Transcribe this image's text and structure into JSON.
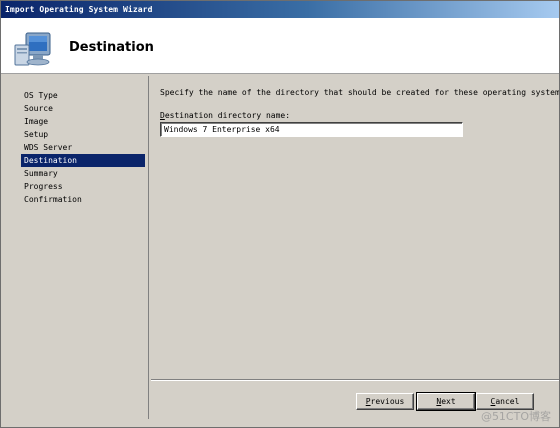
{
  "window": {
    "title": "Import Operating System Wizard"
  },
  "header": {
    "title": "Destination",
    "icon": "computer-monitor-icon"
  },
  "sidebar": {
    "items": [
      {
        "label": "OS Type",
        "selected": false
      },
      {
        "label": "Source",
        "selected": false
      },
      {
        "label": "Image",
        "selected": false
      },
      {
        "label": "Setup",
        "selected": false
      },
      {
        "label": "WDS Server",
        "selected": false
      },
      {
        "label": "Destination",
        "selected": true
      },
      {
        "label": "Summary",
        "selected": false
      },
      {
        "label": "Progress",
        "selected": false
      },
      {
        "label": "Confirmation",
        "selected": false
      }
    ]
  },
  "main": {
    "instruction": "Specify the name of the directory that should be created for these operating system fi",
    "field_label_accel": "D",
    "field_label_rest": "estination directory name:",
    "directory_name": "Windows 7 Enterprise x64"
  },
  "footer": {
    "previous_accel": "P",
    "previous_rest": "revious",
    "next_accel": "N",
    "next_rest": "ext",
    "cancel_accel": "C",
    "cancel_rest": "ancel"
  },
  "watermark": "@51CTO博客",
  "colors": {
    "titlebar": "#0a246a",
    "selection": "#0a246a",
    "dialog_bg": "#d4d0c8"
  }
}
